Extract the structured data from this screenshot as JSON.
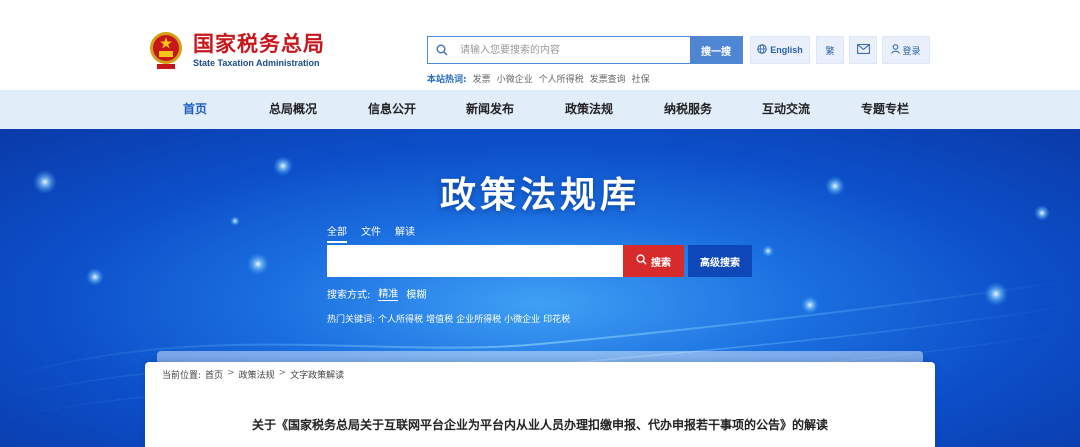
{
  "header": {
    "logo_cn": "国家税务总局",
    "logo_en": "State Taxation Administration",
    "search_placeholder": "请输入您要搜索的内容",
    "search_button": "搜一搜",
    "hot_label": "本站热词:",
    "hot_words": [
      "发票",
      "小微企业",
      "个人所得税",
      "发票查询",
      "社保"
    ],
    "english_label": "English",
    "traditional_label": "繁",
    "login_label": "登录"
  },
  "nav": {
    "items": [
      "首页",
      "总局概况",
      "信息公开",
      "新闻发布",
      "政策法规",
      "纳税服务",
      "互动交流",
      "专题专栏"
    ]
  },
  "banner": {
    "title": "政策法规库",
    "tabs": [
      "全部",
      "文件",
      "解读"
    ],
    "search_button": "搜索",
    "advanced_button": "高级搜索",
    "mode_label": "搜索方式:",
    "mode_options": [
      "精准",
      "模糊"
    ],
    "hot_keywords_label": "热门关键词:",
    "hot_keywords": [
      "个人所得税",
      "增值税",
      "企业所得税",
      "小微企业",
      "印花税"
    ]
  },
  "content": {
    "breadcrumb": [
      "当前位置:",
      "首页",
      "政策法规",
      "文字政策解读"
    ],
    "breadcrumb_sep": ">",
    "article_title": "关于《国家税务总局关于互联网平台企业为平台内从业人员办理扣缴申报、代办申报若干事项的公告》的解读"
  },
  "colors": {
    "brand_red": "#c8161d",
    "accent_blue": "#4f86d3",
    "nav_bg": "#e2edfa",
    "search_red": "#d72a2a"
  }
}
